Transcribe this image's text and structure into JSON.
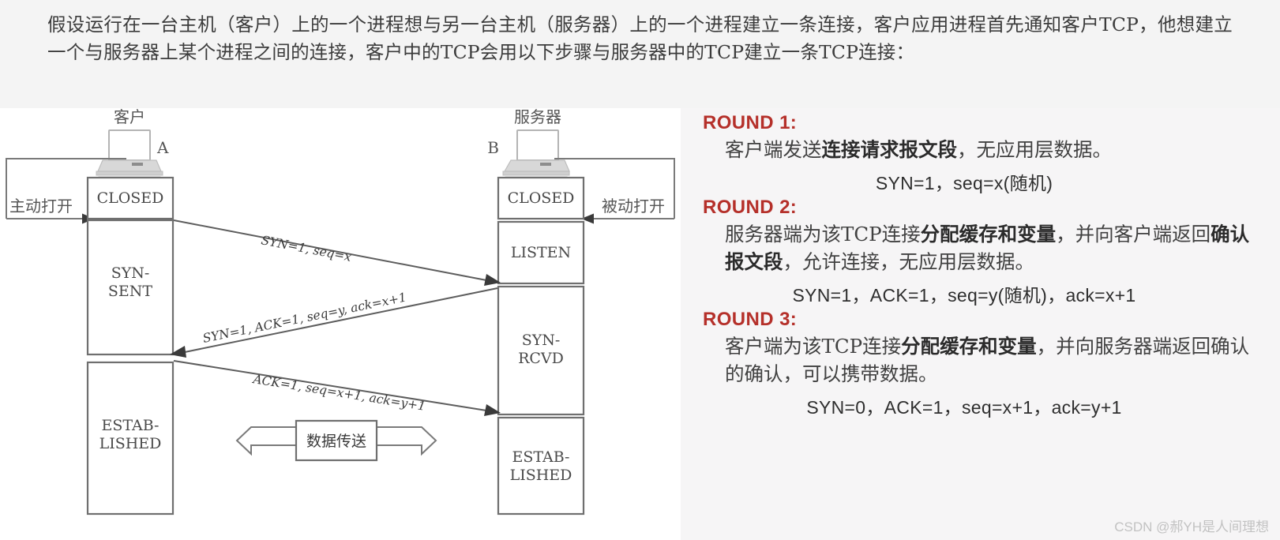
{
  "intro": {
    "paragraph": "假设运行在一台主机（客户）上的一个进程想与另一台主机（服务器）上的一个进程建立一条连接，客户应用进程首先通知客户TCP，他想建立一个与服务器上某个进程之间的连接，客户中的TCP会用以下步骤与服务器中的TCP建立一条TCP连接："
  },
  "diagram": {
    "client": {
      "host_label": "客户",
      "node_letter": "A",
      "open_label": "主动打开",
      "states": [
        "CLOSED",
        "SYN-\nSENT",
        "ESTAB-\nLISHED"
      ],
      "state_closed": "CLOSED",
      "state_syn_sent_line1": "SYN-",
      "state_syn_sent_line2": "SENT",
      "state_estab_line1": "ESTAB-",
      "state_estab_line2": "LISHED"
    },
    "server": {
      "host_label": "服务器",
      "node_letter": "B",
      "open_label": "被动打开",
      "state_closed": "CLOSED",
      "state_listen": "LISTEN",
      "state_syn_rcvd_line1": "SYN-",
      "state_syn_rcvd_line2": "RCVD",
      "state_estab_line1": "ESTAB-",
      "state_estab_line2": "LISHED"
    },
    "segments": [
      {
        "id": "seg1",
        "label": "SYN=1, seq=x",
        "direction": "client-to-server"
      },
      {
        "id": "seg2",
        "label": "SYN=1, ACK=1, seq=y, ack=x+1",
        "direction": "server-to-client"
      },
      {
        "id": "seg3",
        "label": "ACK=1, seq=x+1, ack=y+1",
        "direction": "client-to-server"
      }
    ],
    "data_transfer_label": "数据传送"
  },
  "rounds": [
    {
      "heading": "ROUND 1:",
      "body_pre": "客户端发送",
      "body_bold": "连接请求报文段",
      "body_post": "，无应用层数据。",
      "formula": "SYN=1，seq=x(随机)"
    },
    {
      "heading": "ROUND 2:",
      "body_pre": "服务器端为该TCP连接",
      "body_bold": "分配缓存和变量",
      "body_mid": "，并向客户端返回",
      "body_bold2": "确认报文段",
      "body_post": "，允许连接，无应用层数据。",
      "formula": "SYN=1，ACK=1，seq=y(随机)，ack=x+1"
    },
    {
      "heading": "ROUND 3:",
      "body_pre": "客户端为该TCP连接",
      "body_bold": "分配缓存和变量",
      "body_post": "，并向服务器端返回确认的确认，可以携带数据。",
      "formula": "SYN=0，ACK=1，seq=x+1，ack=y+1"
    }
  ],
  "watermark": "CSDN @郝YH是人间理想",
  "colors": {
    "accent_red": "#b5302a",
    "page_background": "#f4f4f4",
    "diagram_background": "#ffffff",
    "rounds_background": "#f6f5f6",
    "box_stroke": "#6f6f6f"
  }
}
